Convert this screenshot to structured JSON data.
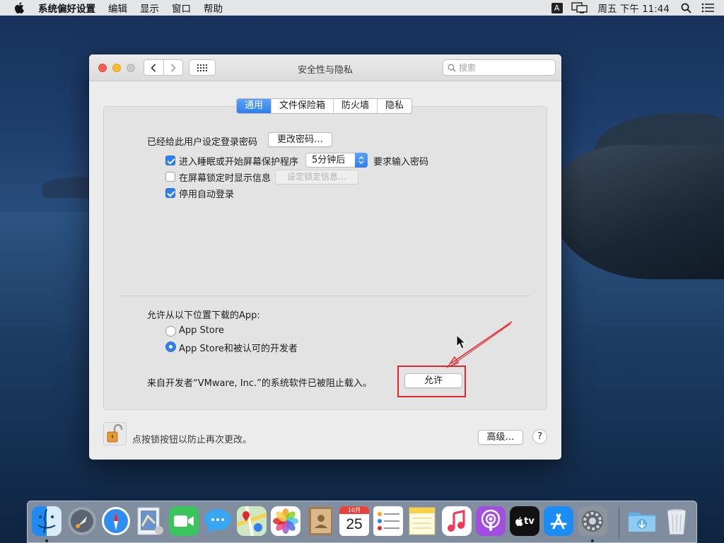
{
  "menubar": {
    "app_name": "系统偏好设置",
    "menus": [
      "编辑",
      "显示",
      "窗口",
      "帮助"
    ],
    "input_method": "A",
    "clock": "周五 下午 11:44"
  },
  "window": {
    "title": "安全性与隐私",
    "search_placeholder": "搜索",
    "tabs": [
      "通用",
      "文件保险箱",
      "防火墙",
      "隐私"
    ],
    "active_tab": "通用"
  },
  "general": {
    "password_label": "已经给此用户设定登录密码",
    "change_password_button": "更改密码…",
    "sleep_require": {
      "label": "进入睡眠或开始屏幕保护程序",
      "checked": true
    },
    "delay_select": "5分钟后",
    "require_password_label": "要求输入密码",
    "show_message": {
      "label": "在屏幕锁定时显示信息",
      "checked": false
    },
    "set_lock_message_button": "设定锁定信息…",
    "disable_autologin": {
      "label": "停用自动登录",
      "checked": true
    }
  },
  "downloads": {
    "heading": "允许从以下位置下载的App:",
    "options": [
      {
        "label": "App Store",
        "selected": false
      },
      {
        "label": "App Store和被认可的开发者",
        "selected": true
      }
    ],
    "blocked_message": "来自开发者“VMware, Inc.”的系统软件已被阻止载入。",
    "allow_button": "允许"
  },
  "footer": {
    "lock_message": "点按锁按钮以防止再次更改。",
    "advanced_button": "高级…",
    "help_button": "?"
  },
  "dock": {
    "calendar_month": "10月",
    "calendar_day": "25",
    "tv_label": "tv"
  },
  "colors": {
    "accent": "#2f80ed",
    "annotation_red": "#e2262b"
  }
}
